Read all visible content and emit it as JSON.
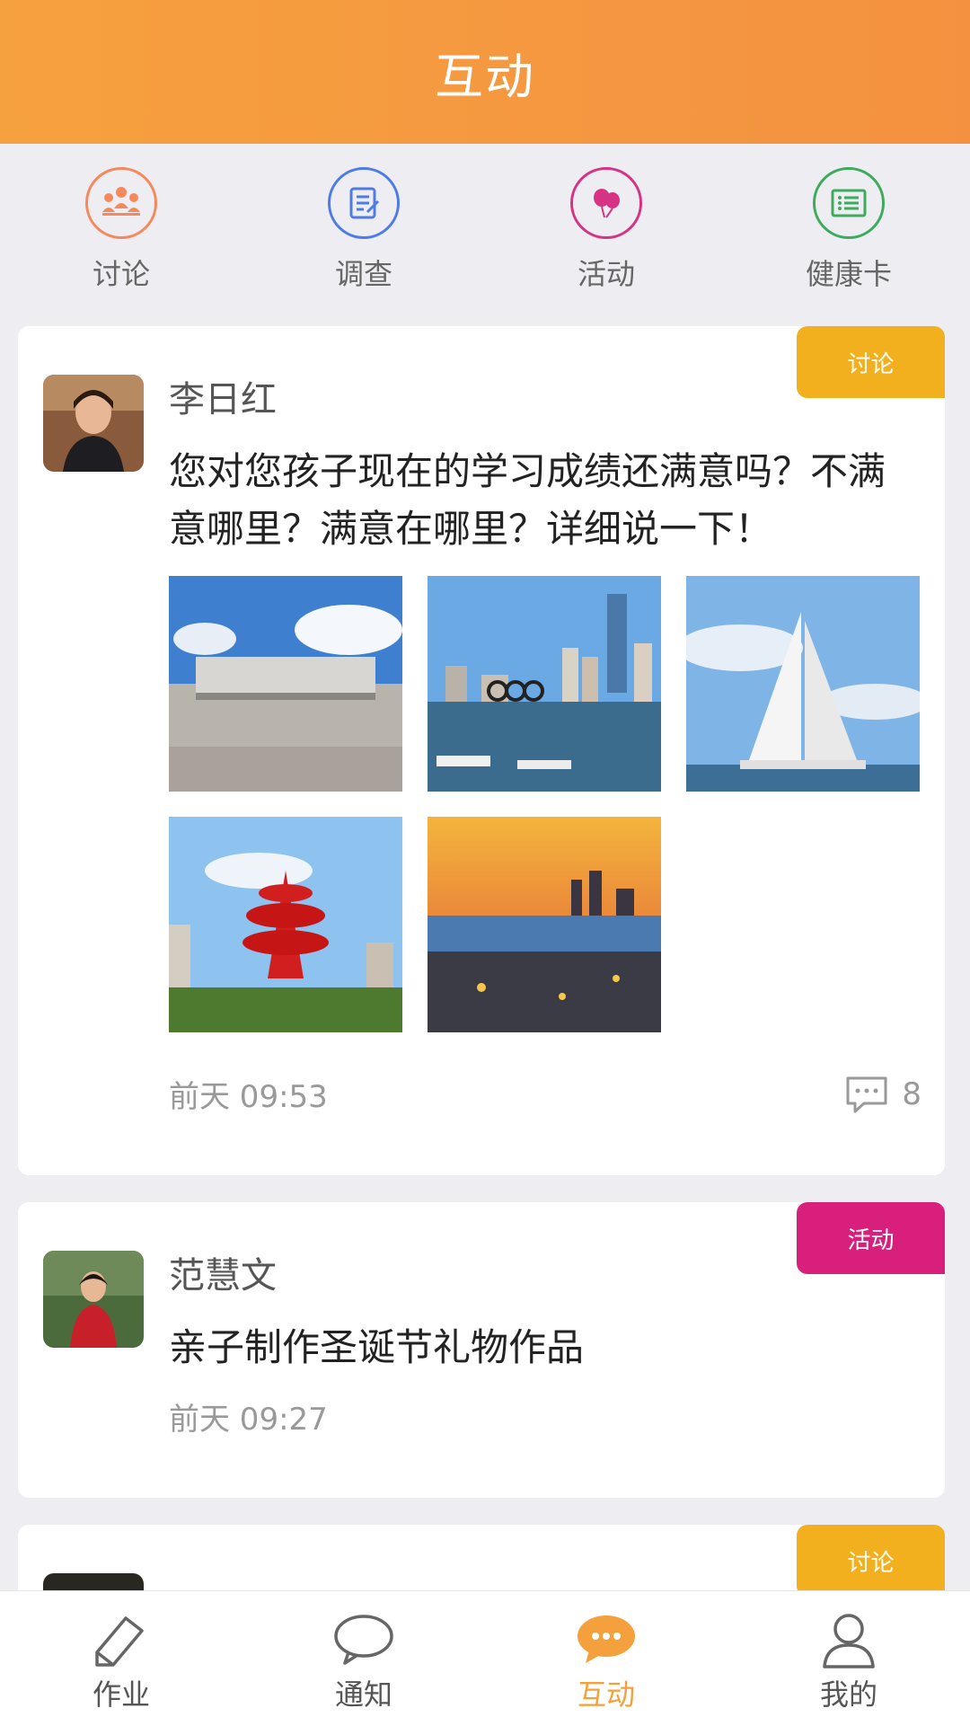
{
  "header": {
    "title": "互动"
  },
  "quick_actions": [
    {
      "label": "讨论",
      "icon": "discussion-icon",
      "color": "#f5895c"
    },
    {
      "label": "调查",
      "icon": "survey-icon",
      "color": "#4f7be8"
    },
    {
      "label": "活动",
      "icon": "balloon-icon",
      "color": "#d63384"
    },
    {
      "label": "健康卡",
      "icon": "health-card-icon",
      "color": "#3daa5e"
    }
  ],
  "posts": [
    {
      "tag": "讨论",
      "tag_color": "#f2b01f",
      "author": "李日红",
      "text": "您对您孩子现在的学习成绩还满意吗？不满意哪里？满意在哪里？详细说一下！",
      "photos": [
        "stadium-photo",
        "harbor-olympic-rings-photo",
        "sailboat-photo",
        "red-sculpture-photo",
        "city-sunset-photo"
      ],
      "time": "前天 09:53",
      "comment_count": "8"
    },
    {
      "tag": "活动",
      "tag_color": "#d81f7c",
      "author": "范慧文",
      "text": "亲子制作圣诞节礼物作品",
      "time": "前天 09:27"
    },
    {
      "tag": "讨论",
      "tag_color": "#f2b01f"
    }
  ],
  "tabbar": [
    {
      "label": "作业",
      "icon": "pencil-icon",
      "active": false
    },
    {
      "label": "通知",
      "icon": "speech-bubble-icon",
      "active": false
    },
    {
      "label": "互动",
      "icon": "chat-dots-icon",
      "active": true
    },
    {
      "label": "我的",
      "icon": "person-icon",
      "active": false
    }
  ],
  "colors": {
    "accent": "#f4a03c",
    "header": "#f59a3e"
  }
}
